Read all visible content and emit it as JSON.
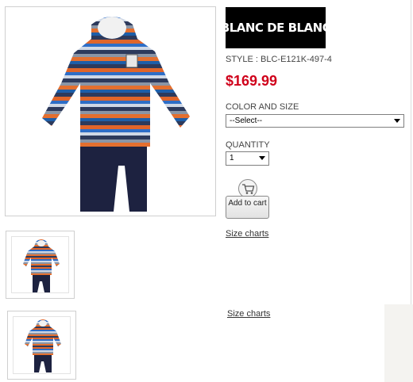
{
  "brand": {
    "logo_text": "BLANC DE BLANC"
  },
  "product": {
    "style_label": "STYLE : BLC-E121K-497-4",
    "price": "$169.99"
  },
  "color_size": {
    "label": "COLOR AND SIZE",
    "selected": "--Select--"
  },
  "quantity": {
    "label": "QUANTITY",
    "selected": "1"
  },
  "cart": {
    "add_label": "Add to cart",
    "icon": "shopping-cart-icon"
  },
  "links": {
    "size_charts_1": "Size charts",
    "size_charts_2": "Size charts"
  }
}
